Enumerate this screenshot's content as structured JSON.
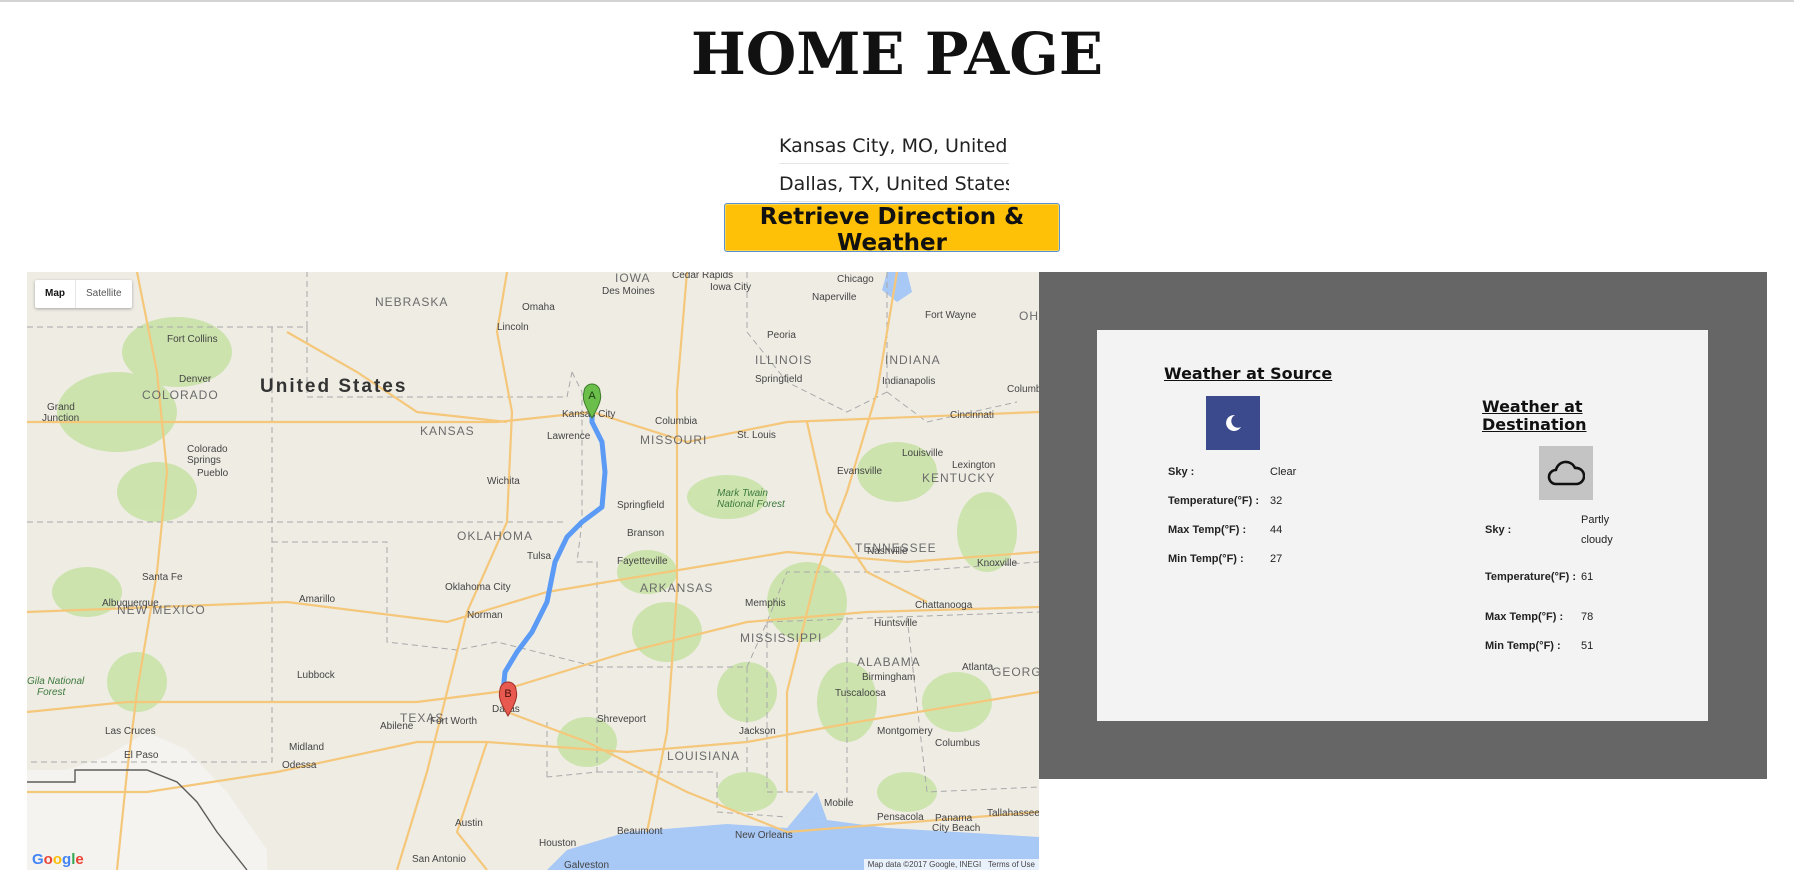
{
  "page": {
    "title": "HOME PAGE"
  },
  "form": {
    "source_value": "Kansas City, MO, United States",
    "destination_value": "Dallas, TX, United States",
    "button_label": "Retrieve Direction & Weather"
  },
  "map": {
    "type_controls": {
      "map_label": "Map",
      "satellite_label": "Satellite",
      "selected": "Map"
    },
    "google_logo": "Google",
    "attribution": "Map data ©2017 Google, INEGI",
    "terms_label": "Terms of Use",
    "marker_a_label": "A",
    "marker_b_label": "B",
    "route_color": "#5b9bf5",
    "labels": {
      "country": "United States",
      "states": [
        "NEBRASKA",
        "IOWA",
        "ILLINOIS",
        "INDIANA",
        "COLORADO",
        "KANSAS",
        "MISSOURI",
        "KENTUCKY",
        "OKLAHOMA",
        "ARKANSAS",
        "TENNESSEE",
        "NEW MEXICO",
        "MISSISSIPPI",
        "ALABAMA",
        "GEORGIA",
        "TEXAS",
        "LOUISIANA",
        "OHIO"
      ],
      "cities": [
        "Omaha",
        "Des Moines",
        "Cedar Rapids",
        "Iowa City",
        "Chicago",
        "Naperville",
        "Fort Wayne",
        "Lincoln",
        "Peoria",
        "Fort Collins",
        "Springfield",
        "Indianapolis",
        "Denver",
        "Kansas City",
        "Cincinnati",
        "Columbus",
        "Grand Junction",
        "Lawrence",
        "Columbia",
        "St. Louis",
        "Colorado Springs",
        "Louisville",
        "Lexington",
        "Pueblo",
        "Evansville",
        "Wichita",
        "Springfield",
        "Mark Twain National Forest",
        "Branson",
        "Nashville",
        "Knoxville",
        "Tulsa",
        "Fayetteville",
        "Santa Fe",
        "Albuquerque",
        "Amarillo",
        "Oklahoma City",
        "Memphis",
        "Chattanooga",
        "Norman",
        "Huntsville",
        "Lubbock",
        "Birmingham",
        "Atlanta",
        "Gila National Forest",
        "Tuscaloosa",
        "Dallas",
        "Fort Worth",
        "Abilene",
        "Shreveport",
        "Jackson",
        "Montgomery",
        "Columbus",
        "Las Cruces",
        "El Paso",
        "Midland",
        "Odessa",
        "Mobile",
        "Pensacola",
        "Panama City Beach",
        "Tallahassee",
        "Austin",
        "Houston",
        "Beaumont",
        "New Orleans",
        "San Antonio",
        "Galveston"
      ]
    }
  },
  "weather": {
    "source": {
      "heading": "Weather at Source",
      "icon": "moon-icon",
      "icon_bg": "#3b4a8c",
      "rows": [
        {
          "label": "Sky :",
          "value": "Clear"
        },
        {
          "label": "Temperature(°F) :",
          "value": "32"
        },
        {
          "label": "Max Temp(°F) :",
          "value": "44"
        },
        {
          "label": "Min Temp(°F) :",
          "value": "27"
        }
      ]
    },
    "destination": {
      "heading": "Weather at Destination",
      "icon": "cloud-icon",
      "icon_bg": "#c4c4c4",
      "rows": [
        {
          "label": "Sky :",
          "value": "Partly cloudy"
        },
        {
          "label": "Temperature(°F) :",
          "value": "61"
        },
        {
          "label": "Max Temp(°F) :",
          "value": "78"
        },
        {
          "label": "Min Temp(°F) :",
          "value": "51"
        }
      ]
    }
  }
}
